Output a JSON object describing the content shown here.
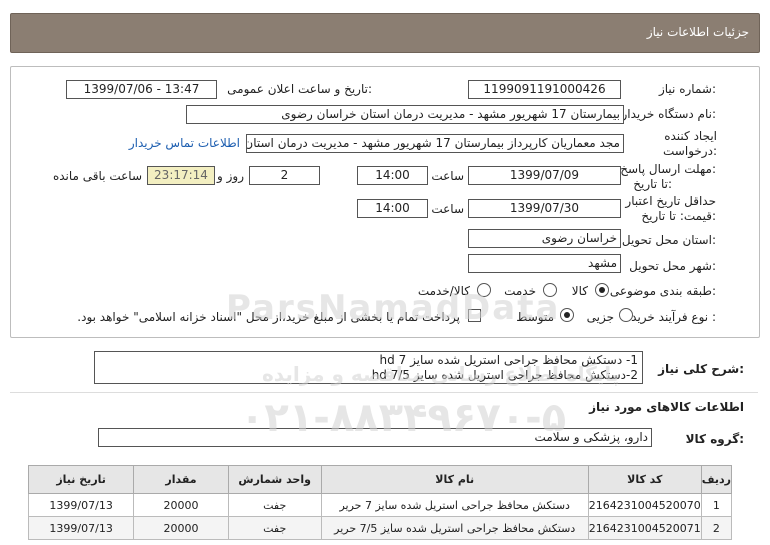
{
  "header": {
    "title": "جزئیات اطلاعات نیاز"
  },
  "form": {
    "need_number_label": "شماره نیاز:",
    "need_number": "1199091191000426",
    "announce_label": "تاریخ و ساعت اعلان عمومی:",
    "announce_value": "1399/07/06 - 13:47",
    "buyer_label": "نام دستگاه خریدار:",
    "buyer_value": "بیمارستان 17 شهریور مشهد - مدیریت درمان استان خراسان رضوی",
    "creator_label_1": "ایجاد کننده",
    "creator_label_2": "درخواست:",
    "creator_value": "مجد معماریان کارپرداز بیمارستان 17 شهریور مشهد - مدیریت درمان استان خراسان رضوی",
    "contact_link": "اطلاعات تماس خریدار",
    "deadline_label_1": "مهلت ارسال پاسخ:",
    "deadline_label_2": "تا تاریخ:",
    "deadline_date": "1399/07/09",
    "time_label": "ساعت",
    "deadline_time": "14:00",
    "days_value": "2",
    "days_label": "روز و",
    "remaining_time": "23:17:14",
    "remaining_label": "ساعت باقی مانده",
    "validity_label_1": "حداقل تاریخ اعتبار",
    "validity_label_2": "قیمت: تا تاریخ:",
    "validity_date": "1399/07/30",
    "validity_time": "14:00",
    "province_label": "استان محل تحویل:",
    "province_value": "خراسان رضوی",
    "city_label": "شهر محل تحویل:",
    "city_value": "مشهد",
    "category_label": "طبقه بندی موضوعی:",
    "category_options": [
      "کالا",
      "خدمت",
      "کالا/خدمت"
    ],
    "process_label": "نوع فرآیند خرید :",
    "process_options": [
      "جزیی",
      "متوسط"
    ],
    "payment_note": "پرداخت تمام یا بخشی از مبلغ خرید،از محل \"اسناد خزانه اسلامی\" خواهد بود."
  },
  "description": {
    "label": "شرح کلی نیاز:",
    "line1": "1- دستکش محافظ جراحی استریل شده سایز 7 hd",
    "line2": "2-دستکش محافظ جراحی استریل شده سایز 7/5 hd"
  },
  "goods": {
    "section_title": "اطلاعات کالاهای مورد نیاز",
    "group_label": "گروه کالا:",
    "group_value": "دارو، پزشکی و سلامت",
    "columns": [
      "ردیف",
      "کد کالا",
      "نام کالا",
      "واحد شمارش",
      "مقدار",
      "تاریخ نیاز"
    ],
    "rows": [
      [
        "1",
        "2164231004520070",
        "دستکش محافظ جراحی استریل شده سایز 7 حریر",
        "جفت",
        "20000",
        "1399/07/13"
      ],
      [
        "2",
        "2164231004520071",
        "دستکش محافظ جراحی استریل شده سایز 7/5 حریر",
        "جفت",
        "20000",
        "1399/07/13"
      ]
    ]
  },
  "watermark": {
    "brand": "ParsNamadData",
    "line1": "پایگاه اطلاع رسانی مناقصه و مزایده",
    "phone": "۰۲۱-۸۸۳۴۹۶۷۰-۵"
  }
}
